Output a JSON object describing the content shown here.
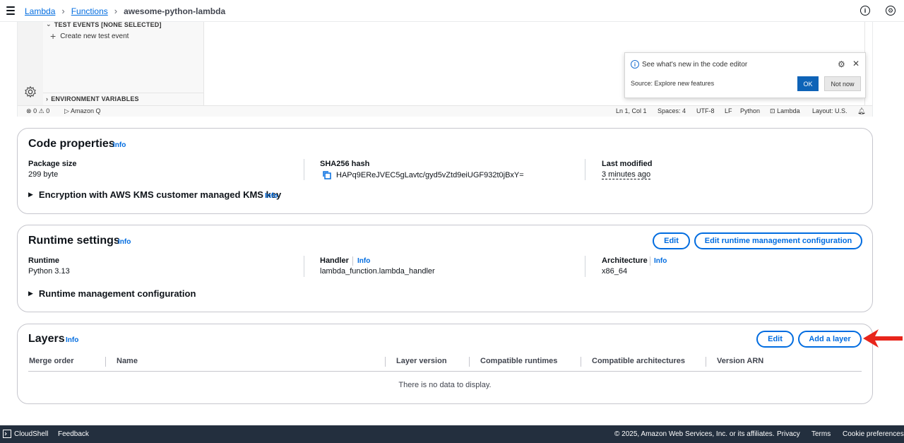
{
  "breadcrumbs": {
    "lambda": "Lambda",
    "functions": "Functions",
    "current": "awesome-python-lambda"
  },
  "editor": {
    "test_events_header": "TEST EVENTS [NONE SELECTED]",
    "create_test_event": "Create new test event",
    "env_vars_header": "ENVIRONMENT VARIABLES",
    "status": {
      "errors": "0",
      "warnings": "0",
      "amazon_q": "Amazon Q",
      "position": "Ln 1, Col 1",
      "spaces": "Spaces: 4",
      "encoding": "UTF-8",
      "eol": "LF",
      "language": "Python",
      "lambda": "Lambda",
      "layout": "Layout: U.S."
    },
    "popup": {
      "title": "See what's new in the code editor",
      "source": "Source: Explore new features",
      "ok": "OK",
      "not_now": "Not now"
    }
  },
  "code_properties": {
    "title": "Code properties",
    "info": "Info",
    "package_size_label": "Package size",
    "package_size": "299 byte",
    "sha_label": "SHA256 hash",
    "sha": "HAPq9EReJVEC5gLavtc/gyd5vZtd9eiUGF932t0jBxY=",
    "last_modified_label": "Last modified",
    "last_modified": "3 minutes ago",
    "encryption": "Encryption with AWS KMS customer managed KMS key",
    "encryption_info": "Info"
  },
  "runtime_settings": {
    "title": "Runtime settings",
    "info": "Info",
    "edit": "Edit",
    "edit_runtime_mgmt": "Edit runtime management configuration",
    "runtime_label": "Runtime",
    "runtime": "Python 3.13",
    "handler_label": "Handler",
    "handler_info": "Info",
    "handler": "lambda_function.lambda_handler",
    "architecture_label": "Architecture",
    "architecture_info": "Info",
    "architecture": "x86_64",
    "runtime_mgmt": "Runtime management configuration"
  },
  "layers": {
    "title": "Layers",
    "info": "Info",
    "edit": "Edit",
    "add_layer": "Add a layer",
    "columns": [
      "Merge order",
      "Name",
      "Layer version",
      "Compatible runtimes",
      "Compatible architectures",
      "Version ARN"
    ],
    "empty": "There is no data to display."
  },
  "footer": {
    "cloudshell": "CloudShell",
    "feedback": "Feedback",
    "copyright": "© 2025, Amazon Web Services, Inc. or its affiliates.",
    "privacy": "Privacy",
    "terms": "Terms",
    "cookies": "Cookie preferences"
  },
  "colors": {
    "link": "#006ce0",
    "footer_bg": "#232f3e",
    "arrow": "#e8251b",
    "ok_button": "#0e63b7"
  }
}
